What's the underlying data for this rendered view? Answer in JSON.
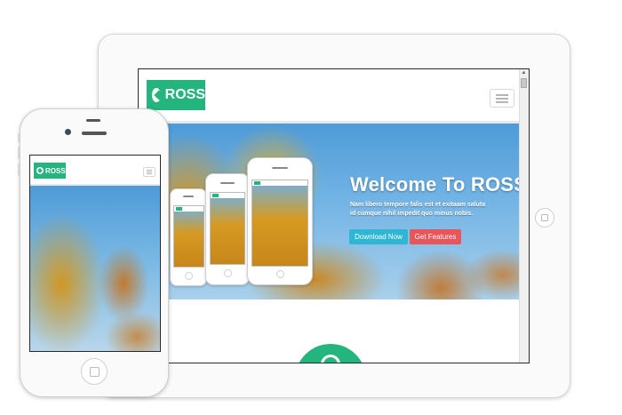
{
  "brand": {
    "name": "ROSS",
    "color": "#24b47e"
  },
  "hero": {
    "title": "Welcome To ROSS",
    "text": "Nam libero tempore falis est et exitaam saluta id cumque nihil impedit quo minus nobis.",
    "buttons": {
      "download": "Download Now",
      "features": "Get Features"
    },
    "button_colors": {
      "download": "#2eb6d2",
      "features": "#e8555a"
    }
  },
  "icons": {
    "logo": "compass-icon",
    "menu": "hamburger-menu-icon",
    "scroll_up": "scroll-up-arrow-icon",
    "home": "home-button-icon"
  }
}
